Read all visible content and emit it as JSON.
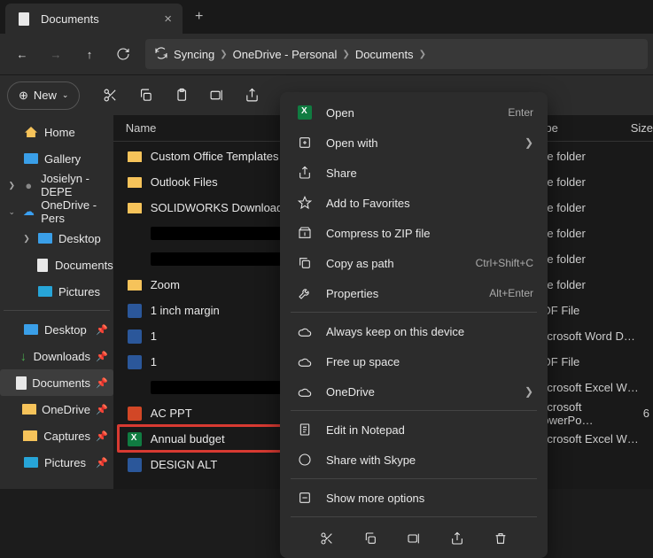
{
  "titlebar": {
    "tab_label": "Documents"
  },
  "nav": {
    "sync_label": "Syncing",
    "crumb1": "OneDrive - Personal",
    "crumb2": "Documents"
  },
  "toolbar": {
    "new_label": "New"
  },
  "sidebar": {
    "home": "Home",
    "gallery": "Gallery",
    "josielyn": "Josielyn - DEPE",
    "onedrive_pers": "OneDrive - Pers",
    "od_desktop": "Desktop",
    "od_documents": "Documents",
    "od_pictures": "Pictures",
    "desktop": "Desktop",
    "downloads": "Downloads",
    "documents": "Documents",
    "onedrive": "OneDrive",
    "captures": "Captures",
    "pictures": "Pictures"
  },
  "columns": {
    "name": "Name",
    "type": "Type",
    "size": "Size"
  },
  "files": [
    {
      "name": "Custom Office Templates",
      "type": "File folder",
      "size": "",
      "icon": "folder"
    },
    {
      "name": "Outlook Files",
      "type": "File folder",
      "size": "",
      "icon": "folder"
    },
    {
      "name": "SOLIDWORKS Downloads",
      "type": "File folder",
      "size": "",
      "icon": "folder"
    },
    {
      "name": "(redacted)",
      "type": "File folder",
      "size": "",
      "icon": "redact"
    },
    {
      "name": "(redacted)",
      "type": "File folder",
      "size": "",
      "icon": "redact"
    },
    {
      "name": "Zoom",
      "type": "File folder",
      "size": "",
      "icon": "folder"
    },
    {
      "name": "1 inch margin",
      "type": "PDF File",
      "size": "",
      "icon": "word"
    },
    {
      "name": "1",
      "type": "Microsoft Word D…",
      "size": "",
      "icon": "word"
    },
    {
      "name": "1",
      "type": "PDF File",
      "size": "",
      "icon": "word"
    },
    {
      "name": "(redacted)",
      "type": "Microsoft Excel W…",
      "size": "",
      "icon": "redact"
    },
    {
      "name": "AC PPT",
      "type": "Microsoft PowerPo…",
      "size": "6",
      "icon": "ppt"
    },
    {
      "name": "Annual budget",
      "type": "Microsoft Excel W…",
      "size": "",
      "icon": "excel"
    },
    {
      "name": "DESIGN ALT",
      "type": "",
      "size": "",
      "icon": "word"
    }
  ],
  "context": {
    "open": "Open",
    "open_sc": "Enter",
    "openwith": "Open with",
    "share": "Share",
    "fav": "Add to Favorites",
    "zip": "Compress to ZIP file",
    "copypath": "Copy as path",
    "copypath_sc": "Ctrl+Shift+C",
    "props": "Properties",
    "props_sc": "Alt+Enter",
    "keep": "Always keep on this device",
    "free": "Free up space",
    "onedrive": "OneDrive",
    "notepad": "Edit in Notepad",
    "skype": "Share with Skype",
    "more": "Show more options"
  }
}
